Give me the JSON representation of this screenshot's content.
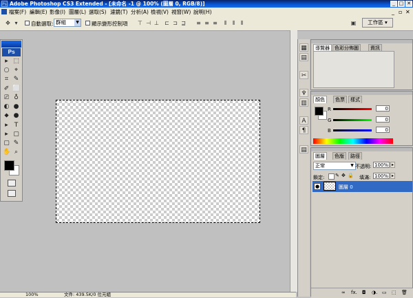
{
  "titlebar": {
    "ps_badge": "Ps",
    "title": "Adobe Photoshop CS3 Extended - [未命名 -1 @ 100% (圖層 0, RGB/8)]",
    "min": "_",
    "max": "□",
    "close": "✕"
  },
  "menu": [
    "檔案(F)",
    "編輯(E)",
    "影像(I)",
    "圖層(L)",
    "選取(S)",
    "濾鏡(T)",
    "分析(A)",
    "檢視(V)",
    "視窗(W)",
    "說明(H)"
  ],
  "options": {
    "auto_select_label": "自動選取:",
    "auto_select_value": "群組",
    "show_transform_label": "顯示變形控制項",
    "workspace_label": "工作區 ▾"
  },
  "toolbox": {
    "logo": "Ps",
    "tools": [
      "▸",
      "⬚",
      "○",
      "⌖",
      "⌗",
      "✎",
      "✐",
      "⬜",
      "⎚",
      "♁",
      "◐",
      "●",
      "⬥",
      "T",
      "▸",
      "▢",
      "✋",
      "⌕"
    ]
  },
  "navigator_panel": {
    "tabs": [
      "導覽器",
      "色彩分佈圖",
      "資訊"
    ]
  },
  "color_panel": {
    "tabs": [
      "顏色",
      "色票",
      "樣式"
    ],
    "channels": [
      {
        "label": "R",
        "value": "0",
        "color": "#cc0000"
      },
      {
        "label": "G",
        "value": "0",
        "color": "#00aa00"
      },
      {
        "label": "B",
        "value": "0",
        "color": "#0000cc"
      }
    ]
  },
  "layers_panel": {
    "tabs": [
      "圖層",
      "色版",
      "路徑"
    ],
    "blend_mode": "正常",
    "opacity_label": "不透明:",
    "opacity_value": "100%",
    "lock_label": "鎖定:",
    "fill_label": "填滿:",
    "fill_value": "100%",
    "layer_name": "圖層 0",
    "bottom_icons": [
      "∞",
      "fx.",
      "◘",
      "◑.",
      "▭",
      "⬚",
      "🗑"
    ]
  },
  "status": {
    "zoom": "100%",
    "doc_info": "文件: 439.5K/0 位元組"
  },
  "colors": {
    "accent": "#316ac5",
    "title_bar": "#0a58d8",
    "workspace": "#c0c0c0",
    "panel": "#d4d0c8"
  }
}
